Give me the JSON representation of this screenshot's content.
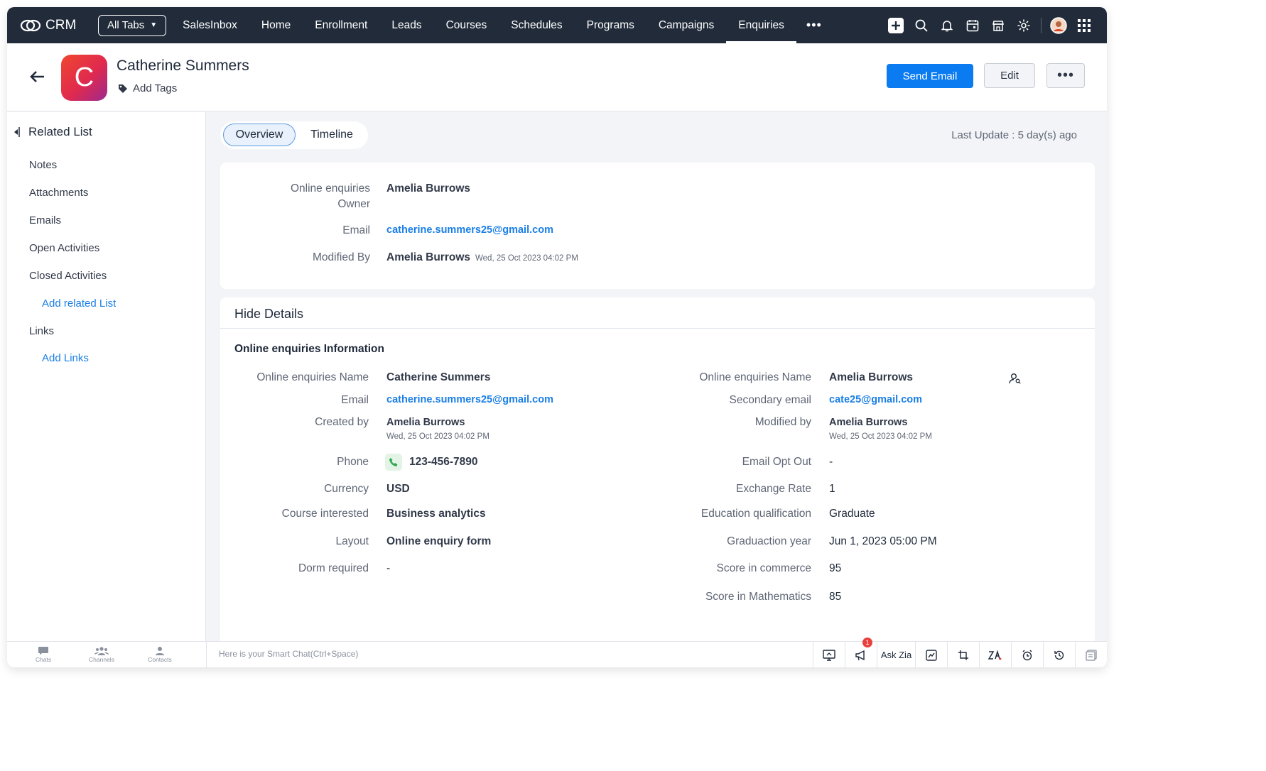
{
  "topnav": {
    "logo_text": "CRM",
    "all_tabs": "All Tabs",
    "tabs": [
      "SalesInbox",
      "Home",
      "Enrollment",
      "Leads",
      "Courses",
      "Schedules",
      "Programs",
      "Campaigns",
      "Enquiries"
    ],
    "active_tab": "Enquiries",
    "more": "•••",
    "icons": [
      "plus-icon",
      "search-icon",
      "bell-icon",
      "calendar-icon",
      "marketplace-icon",
      "gear-icon",
      "user-avatar",
      "apps-grid-icon"
    ]
  },
  "header": {
    "avatar_letter": "C",
    "record_name": "Catherine Summers",
    "add_tags": "Add Tags",
    "send_email": "Send Email",
    "edit": "Edit",
    "more": "•••"
  },
  "sidebar": {
    "title": "Related List",
    "items": [
      "Notes",
      "Attachments",
      "Emails",
      "Open Activities",
      "Closed Activities"
    ],
    "add_related": "Add related List",
    "links": "Links",
    "add_links": "Add Links"
  },
  "main": {
    "tabs": [
      "Overview",
      "Timeline"
    ],
    "last_update": "Last Update : 5 day(s) ago"
  },
  "summary": {
    "owner_label_1": "Online enquiries",
    "owner_label_2": "Owner",
    "owner_value": "Amelia Burrows",
    "email_label": "Email",
    "email_value": "catherine.summers25@gmail.com",
    "modified_label": "Modified By",
    "modified_value": "Amelia Burrows",
    "modified_time": "Wed, 25 Oct 2023 04:02 PM"
  },
  "details": {
    "hide_details": "Hide Details",
    "section_title": "Online enquiries Information",
    "left": {
      "name_label": "Online enquiries Name",
      "name_value": "Catherine Summers",
      "email_label": "Email",
      "email_value": "catherine.summers25@gmail.com",
      "created_label": "Created by",
      "created_value": "Amelia Burrows",
      "created_time": "Wed, 25 Oct 2023 04:02 PM",
      "phone_label": "Phone",
      "phone_value": "123-456-7890",
      "currency_label": "Currency",
      "currency_value": "USD",
      "course_label": "Course interested",
      "course_value": "Business analytics",
      "layout_label": "Layout",
      "layout_value": "Online enquiry form",
      "dorm_label": "Dorm required",
      "dorm_value": "-"
    },
    "right": {
      "name_label": "Online enquiries Name",
      "name_value": "Amelia Burrows",
      "secemail_label": "Secondary email",
      "secemail_value": "cate25@gmail.com",
      "modified_label": "Modified by",
      "modified_value": "Amelia Burrows",
      "modified_time": "Wed, 25 Oct 2023 04:02 PM",
      "optout_label": "Email Opt Out",
      "optout_value": "-",
      "rate_label": "Exchange Rate",
      "rate_value": "1",
      "edu_label": "Education qualification",
      "edu_value": "Graduate",
      "grad_label": "Graduaction year",
      "grad_value": "Jun 1, 2023 05:00 PM",
      "commerce_label": "Score in commerce",
      "commerce_value": "95",
      "math_label": "Score in Mathematics",
      "math_value": "85"
    }
  },
  "footer": {
    "chats": "Chats",
    "channels": "Channels",
    "contacts": "Contacts",
    "smart_chat": "Here is your Smart Chat(Ctrl+Space)",
    "ask_zia": "Ask Zia",
    "notification_count": "1"
  }
}
